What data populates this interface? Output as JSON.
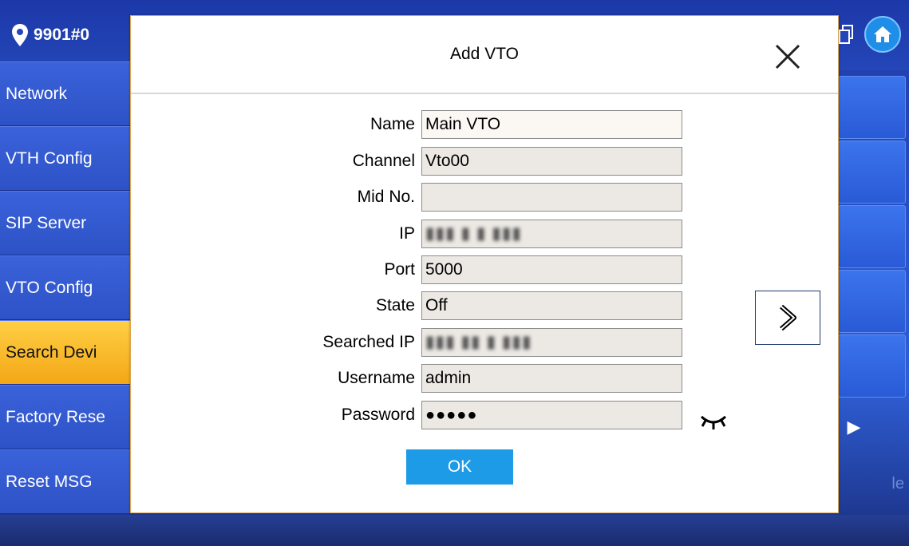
{
  "header": {
    "room_number": "9901#0"
  },
  "sidebar": {
    "items": [
      {
        "label": "Network"
      },
      {
        "label": "VTH Config"
      },
      {
        "label": "SIP Server"
      },
      {
        "label": "VTO Config"
      },
      {
        "label": "Search Devi",
        "active": true
      },
      {
        "label": "Factory Rese"
      },
      {
        "label": "Reset MSG"
      }
    ]
  },
  "background": {
    "partial_label": "le"
  },
  "dialog": {
    "title": "Add VTO",
    "fields": {
      "name": {
        "label": "Name",
        "value": "Main VTO"
      },
      "channel": {
        "label": "Channel",
        "value": "Vto00"
      },
      "mid_no": {
        "label": "Mid No.",
        "value": ""
      },
      "ip": {
        "label": "IP",
        "value": "▮▮▮ ▮ ▮ ▮▮▮"
      },
      "port": {
        "label": "Port",
        "value": "5000"
      },
      "state": {
        "label": "State",
        "value": "Off"
      },
      "searched_ip": {
        "label": "Searched IP",
        "value": "▮▮▮ ▮▮ ▮ ▮▮▮"
      },
      "username": {
        "label": "Username",
        "value": "admin"
      },
      "password": {
        "label": "Password",
        "value": "●●●●●"
      }
    },
    "ok_label": "OK"
  },
  "colors": {
    "accent_blue": "#1e9be6",
    "sidebar_active": "#f3a716",
    "sidebar_bg": "#2e52c6",
    "dialog_border": "#d9a451"
  },
  "icons": {
    "location": "location-pin-icon",
    "home": "home-icon",
    "close": "close-icon",
    "next": "chevron-right-icon",
    "password_toggle": "eye-closed-icon"
  }
}
